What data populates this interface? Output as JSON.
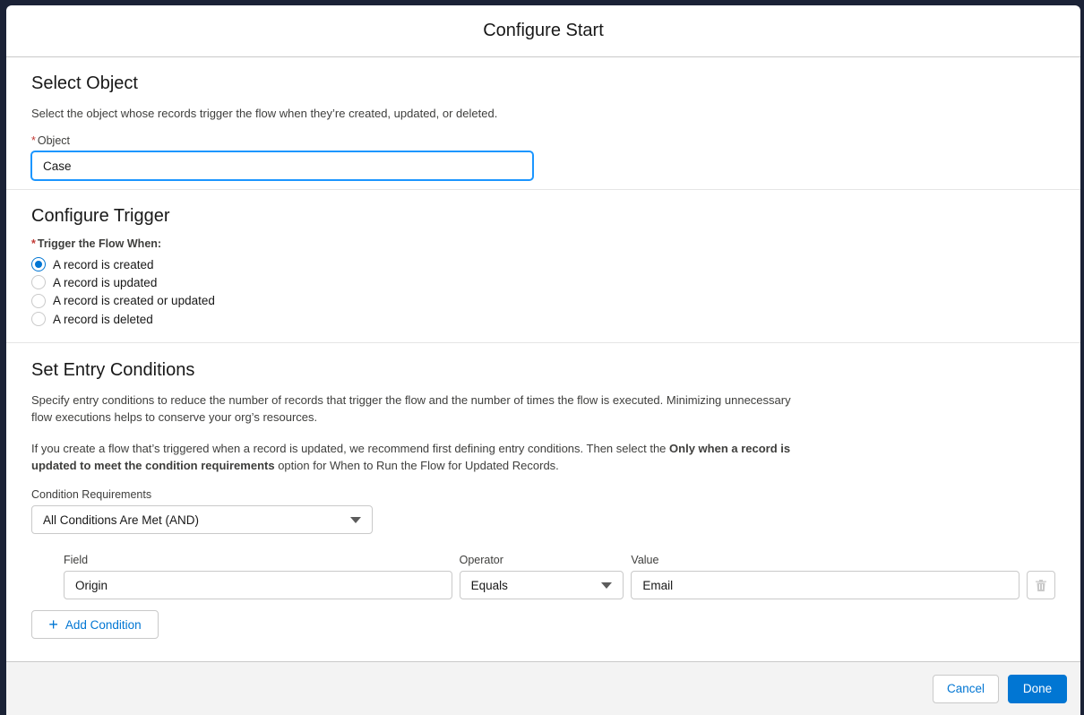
{
  "modal": {
    "title": "Configure Start"
  },
  "select_object": {
    "title": "Select Object",
    "help": "Select the object whose records trigger the flow when they’re created, updated, or deleted.",
    "required_mark": "*",
    "object_label": "Object",
    "object_value": "Case"
  },
  "configure_trigger": {
    "title": "Configure Trigger",
    "required_mark": "*",
    "label": "Trigger the Flow When:",
    "options": [
      {
        "label": "A record is created",
        "checked": true
      },
      {
        "label": "A record is updated",
        "checked": false
      },
      {
        "label": "A record is created or updated",
        "checked": false
      },
      {
        "label": "A record is deleted",
        "checked": false
      }
    ]
  },
  "entry_conditions": {
    "title": "Set Entry Conditions",
    "para1": "Specify entry conditions to reduce the number of records that trigger the flow and the number of times the flow is executed. Minimizing unnecessary flow executions helps to conserve your org’s resources.",
    "para2_prefix": "If you create a flow that’s triggered when a record is updated, we recommend first defining entry conditions. Then select the ",
    "para2_bold": "Only when a record is updated to meet the condition requirements",
    "para2_suffix": " option for When to Run the Flow for Updated Records.",
    "requirements_label": "Condition Requirements",
    "requirements_value": "All Conditions Are Met (AND)",
    "condition": {
      "field_label": "Field",
      "field_value": "Origin",
      "operator_label": "Operator",
      "operator_value": "Equals",
      "value_label": "Value",
      "value_value": "Email"
    },
    "add_condition_label": "Add Condition"
  },
  "footer": {
    "cancel_label": "Cancel",
    "done_label": "Done"
  },
  "colors": {
    "brand": "#0176d3",
    "required": "#c23934",
    "backdrop": "#1b2236"
  }
}
